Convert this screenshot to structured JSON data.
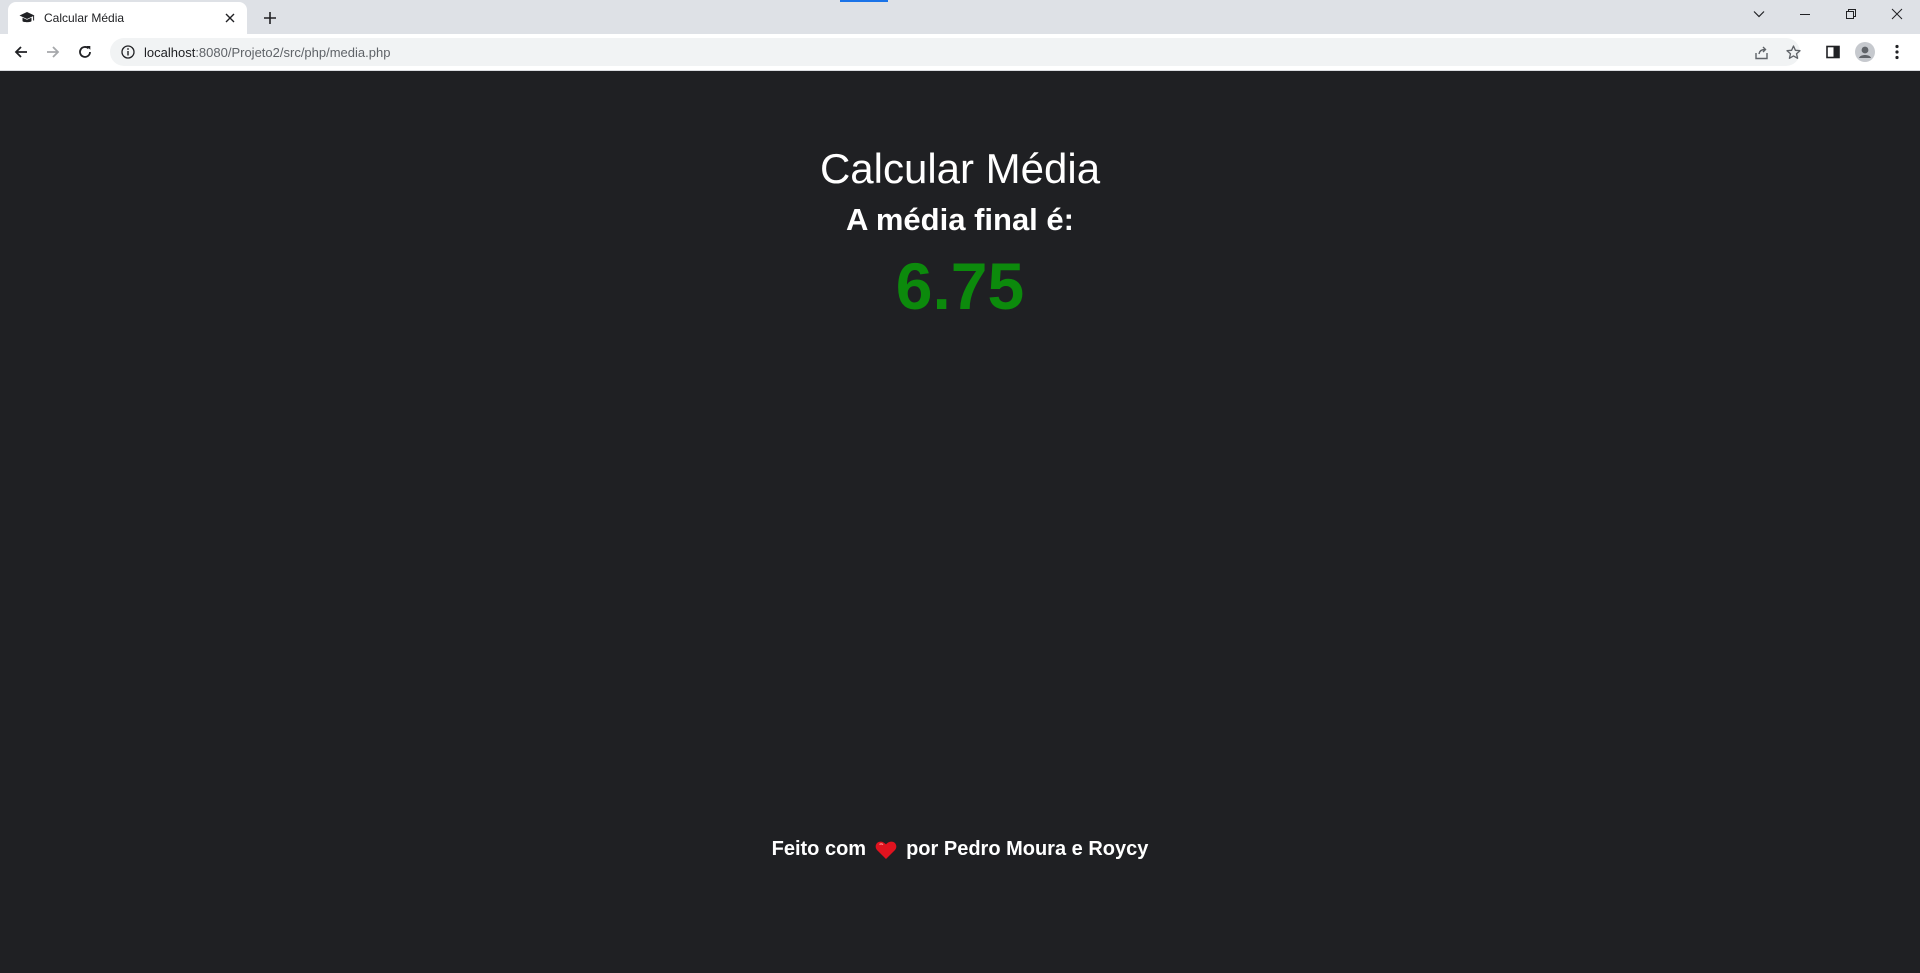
{
  "browser": {
    "tab": {
      "title": "Calcular Média",
      "favicon": "graduation-cap-icon"
    },
    "url": {
      "host": "localhost",
      "path": ":8080/Projeto2/src/php/media.php"
    }
  },
  "page": {
    "title": "Calcular Média",
    "subtitle": "A média final é:",
    "result": "6.75",
    "footer": {
      "prefix": "Feito com",
      "icon": "heart-icon",
      "suffix": "por Pedro Moura e Roycy"
    }
  },
  "colors": {
    "background": "#1f2023",
    "result": "#0c8a0c",
    "text": "#ffffff",
    "heart": "#e0131f"
  }
}
